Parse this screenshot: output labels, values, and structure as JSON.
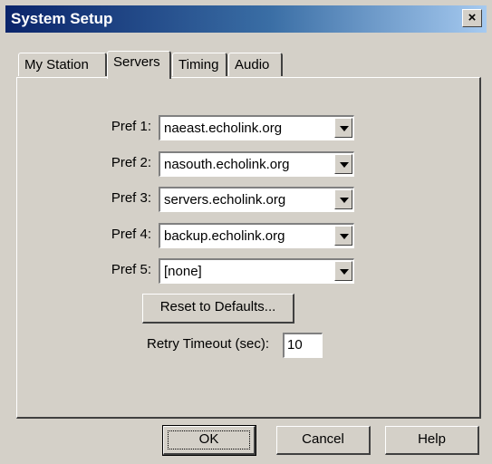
{
  "window": {
    "title": "System Setup",
    "close_label": "×"
  },
  "tabs": [
    {
      "label": "My Station",
      "active": false
    },
    {
      "label": "Servers",
      "active": true
    },
    {
      "label": "Timing",
      "active": false
    },
    {
      "label": "Audio",
      "active": false
    }
  ],
  "servers": [
    {
      "label": "Pref 1:",
      "value": "naeast.echolink.org"
    },
    {
      "label": "Pref 2:",
      "value": "nasouth.echolink.org"
    },
    {
      "label": "Pref 3:",
      "value": "servers.echolink.org"
    },
    {
      "label": "Pref 4:",
      "value": "backup.echolink.org"
    },
    {
      "label": "Pref 5:",
      "value": "[none]"
    }
  ],
  "reset_button": "Reset to Defaults...",
  "retry": {
    "label": "Retry Timeout (sec):",
    "value": "10"
  },
  "buttons": {
    "ok": "OK",
    "cancel": "Cancel",
    "help": "Help"
  }
}
